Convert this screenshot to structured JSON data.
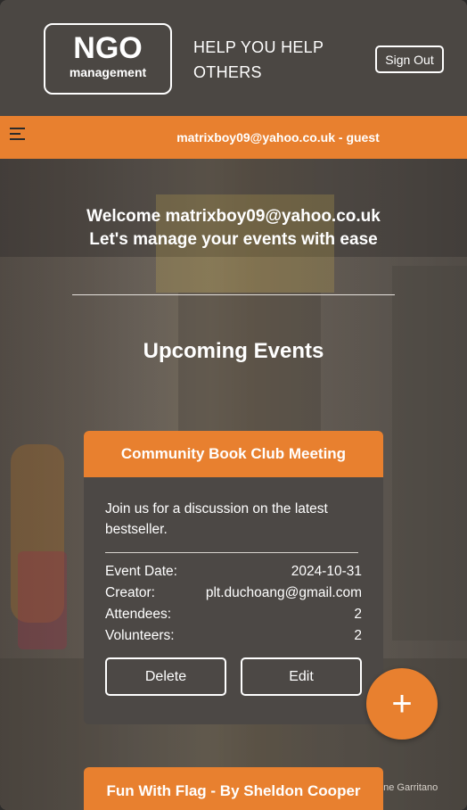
{
  "header": {
    "logo_main": "NGO",
    "logo_sub": "management",
    "tagline": "HELP YOU HELP OTHERS",
    "signout_label": "Sign Out"
  },
  "topbar": {
    "user_label": "matrixboy09@yahoo.co.uk - guest"
  },
  "welcome": {
    "line1": "Welcome matrixboy09@yahoo.co.uk",
    "line2": "Let's manage your events with ease"
  },
  "events_title": "Upcoming Events",
  "events": [
    {
      "title": "Community Book Club Meeting",
      "description": "Join us for a discussion on the latest bestseller.",
      "date_label": "Event Date:",
      "date": "2024-10-31",
      "creator_label": "Creator:",
      "creator": "plt.duchoang@gmail.com",
      "attendees_label": "Attendees:",
      "attendees": "2",
      "volunteers_label": "Volunteers:",
      "volunteers": "2",
      "delete_label": "Delete",
      "edit_label": "Edit"
    },
    {
      "title": "Fun With Flag - By Sheldon Cooper"
    }
  ],
  "fab_label": "+",
  "photo_credit": "one Garritano",
  "colors": {
    "accent": "#e8802f",
    "header_bg": "#4b4743",
    "card_bg": "#4c4845"
  }
}
